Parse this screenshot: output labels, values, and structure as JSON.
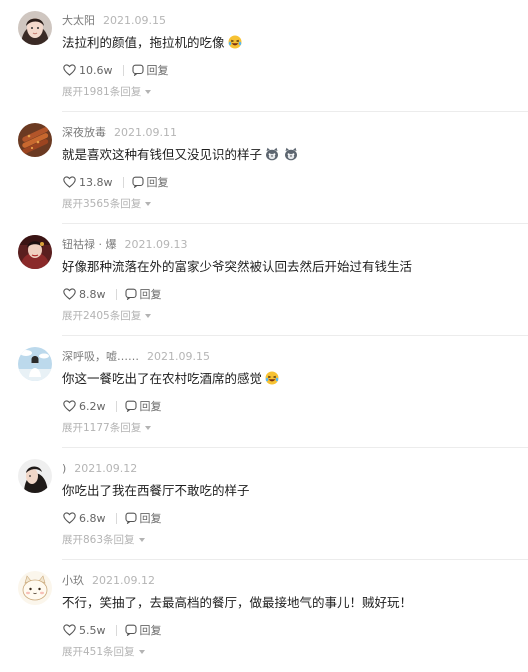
{
  "comments": [
    {
      "username": "大太阳",
      "date": "2021.09.15",
      "text": "法拉利的颜值，拖拉机的吃像",
      "emoji": "laughing-crying-emoji",
      "likes": "10.6w",
      "reply_label": "回复",
      "expand_label": "展开1981条回复"
    },
    {
      "username": "深夜放毒",
      "date": "2021.09.11",
      "text": "就是喜欢这种有钱但又没见识的样子",
      "emoji": "cat-face-emoji",
      "likes": "13.8w",
      "reply_label": "回复",
      "expand_label": "展开3565条回复"
    },
    {
      "username": "钮祜禄 · 爆",
      "date": "2021.09.13",
      "text": "好像那种流落在外的富家少爷突然被认回去然后开始过有钱生活",
      "emoji": "",
      "likes": "8.8w",
      "reply_label": "回复",
      "expand_label": "展开2405条回复"
    },
    {
      "username": "深呼吸，嘘……",
      "date": "2021.09.15",
      "text": "你这一餐吃出了在农村吃酒席的感觉",
      "emoji": "laughing-crying-emoji",
      "likes": "6.2w",
      "reply_label": "回复",
      "expand_label": "展开1177条回复"
    },
    {
      "username": ")",
      "date": "2021.09.12",
      "text": "你吃出了我在西餐厅不敢吃的样子",
      "emoji": "",
      "likes": "6.8w",
      "reply_label": "回复",
      "expand_label": "展开863条回复"
    },
    {
      "username": "小玖",
      "date": "2021.09.12",
      "text": "不行，笑抽了，去最高档的餐厅，做最接地气的事儿！贼好玩！",
      "emoji": "",
      "likes": "5.5w",
      "reply_label": "回复",
      "expand_label": "展开451条回复"
    }
  ],
  "colors": {
    "username": "#7a7a7a",
    "date": "#b5b5b5",
    "text": "#1e1e1e",
    "expand": "#b3b3b3",
    "divider": "#ececec"
  }
}
